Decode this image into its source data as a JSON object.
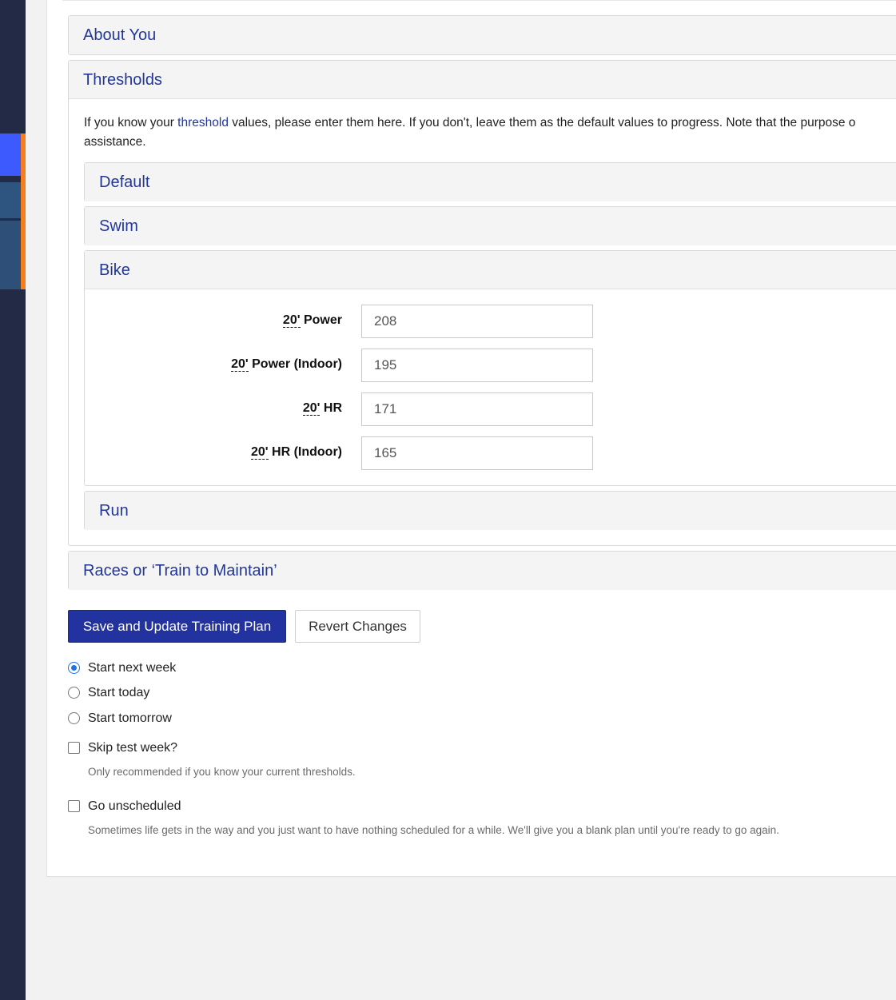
{
  "sections": {
    "about": {
      "title": "About You"
    },
    "thresholds": {
      "title": "Thresholds",
      "intro_before_link": "If you know your ",
      "intro_link": "threshold",
      "intro_after_link": " values, please enter them here. If you don't, leave them as the default values to progress. Note that the purpose o",
      "intro_line2": "assistance.",
      "subsections": {
        "default": {
          "title": "Default"
        },
        "swim": {
          "title": "Swim"
        },
        "bike": {
          "title": "Bike",
          "fields": [
            {
              "abbr": "20'",
              "label": " Power",
              "value": "208"
            },
            {
              "abbr": "20'",
              "label": " Power (Indoor)",
              "value": "195"
            },
            {
              "abbr": "20'",
              "label": " HR",
              "value": "171"
            },
            {
              "abbr": "20'",
              "label": " HR (Indoor)",
              "value": "165"
            }
          ]
        },
        "run": {
          "title": "Run"
        }
      }
    },
    "races": {
      "title": "Races or ‘Train to Maintain’"
    }
  },
  "actions": {
    "save_label": "Save and Update Training Plan",
    "revert_label": "Revert Changes"
  },
  "start_options": [
    {
      "label": "Start next week",
      "checked": true
    },
    {
      "label": "Start today",
      "checked": false
    },
    {
      "label": "Start tomorrow",
      "checked": false
    }
  ],
  "skip_test": {
    "label": "Skip test week?",
    "checked": false,
    "help": "Only recommended if you know your current thresholds."
  },
  "unscheduled": {
    "label": "Go unscheduled",
    "checked": false,
    "help": "Sometimes life gets in the way and you just want to have nothing scheduled for a while. We'll give you a blank plan until you're ready to go again."
  },
  "colors": {
    "primary": "#22339f",
    "heading": "#22379a",
    "sidebar": "#232a45",
    "sidebar_active": "#3d5afe",
    "sidebar_accent": "#f47f20",
    "radio_checked": "#1a73e8"
  }
}
